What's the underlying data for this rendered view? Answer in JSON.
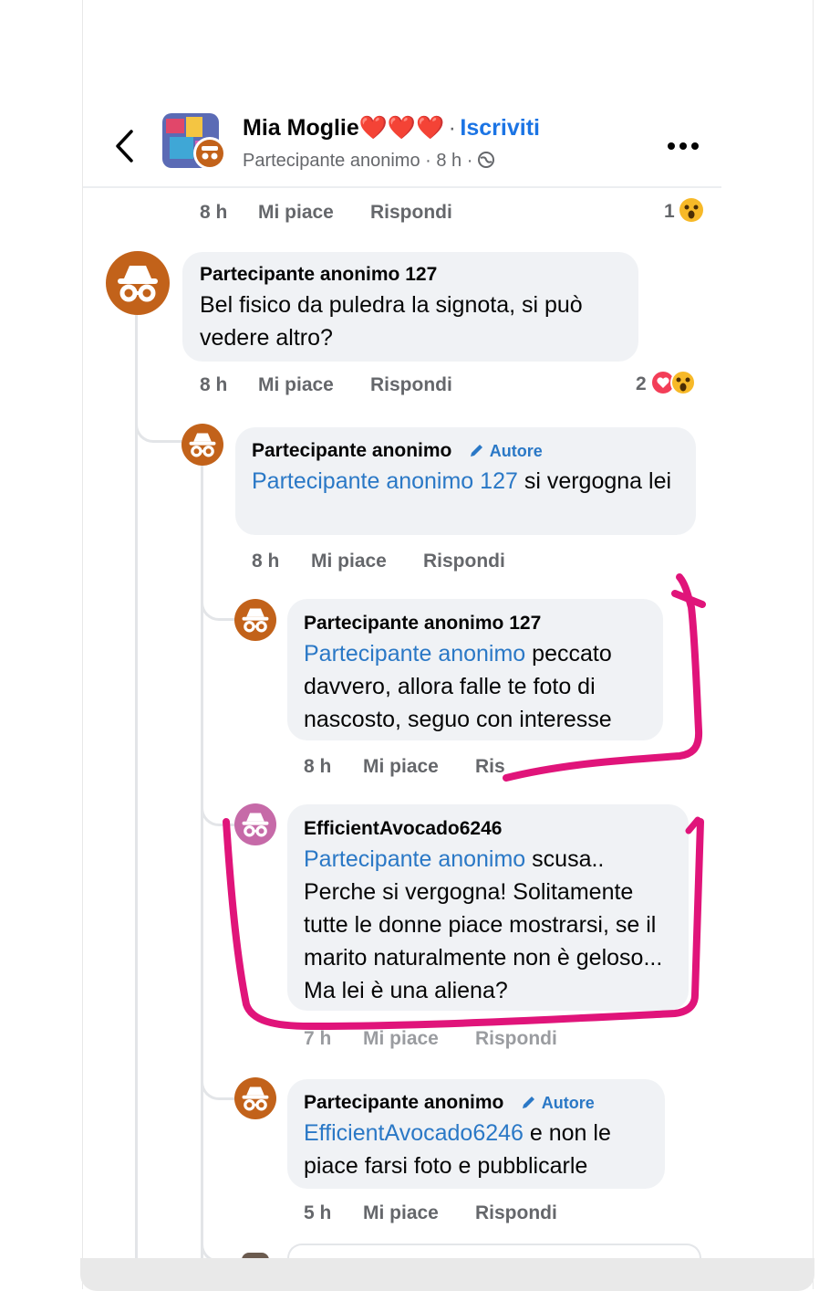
{
  "header": {
    "title": "Mia Moglie",
    "hearts": "❤️❤️❤️",
    "separator": "·",
    "subscribe_label": "Iscriviti",
    "subtitle": "Partecipante anonimo · 8 h ·"
  },
  "top_actions": {
    "time": "8 h",
    "like": "Mi piace",
    "reply": "Rispondi",
    "reaction_count": "1"
  },
  "comments": [
    {
      "author": "Partecipante anonimo 127",
      "badge": "",
      "mention": "",
      "text": "Bel fisico da puledra la signota, si può vedere altro?",
      "time": "8 h",
      "like": "Mi piace",
      "reply": "Rispondi",
      "reaction_count": "2"
    },
    {
      "author": "Partecipante anonimo",
      "badge": "Autore",
      "mention": "Partecipante anonimo 127",
      "text": " si vergogna lei",
      "time": "8 h",
      "like": "Mi piace",
      "reply": "Rispondi"
    },
    {
      "author": "Partecipante anonimo 127",
      "badge": "",
      "mention": "Partecipante anonimo",
      "text": " peccato davvero, allora falle te foto di nascosto, seguo con interesse",
      "time": "8 h",
      "like": "Mi piace",
      "reply": "Ris"
    },
    {
      "author": "EfficientAvocado6246",
      "badge": "",
      "mention": "Partecipante anonimo",
      "text": " scusa.. Perche si vergogna!  Solitamente tutte le donne piace mostrarsi, se il marito naturalmente non è geloso...  Ma lei è una aliena?",
      "time": "7 h",
      "like": "Mi piace",
      "reply": "Rispondi"
    },
    {
      "author": "Partecipante anonimo",
      "badge": "Autore",
      "mention": "EfficientAvocado6246",
      "text": " e non le piace farsi foto e pubblicarle",
      "time": "5 h",
      "like": "Mi piace",
      "reply": "Rispondi"
    }
  ],
  "colors": {
    "avatar": "#c2621a",
    "mention": "#2a78c6",
    "highlight": "#e0147a",
    "bubble": "#f0f2f5"
  },
  "icons": [
    "back-arrow-icon",
    "more-icon",
    "globe-icon",
    "incognito-icon",
    "heart-reaction-icon",
    "wow-reaction-icon",
    "pencil-icon"
  ]
}
